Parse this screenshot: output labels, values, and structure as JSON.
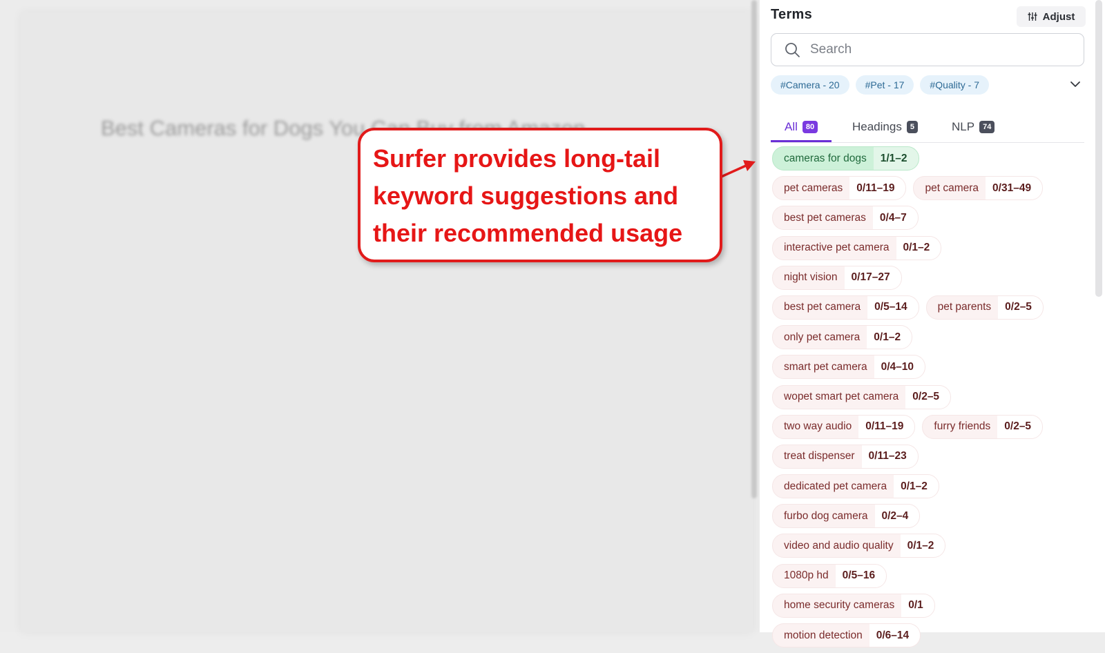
{
  "editor": {
    "title": "Best Cameras for Dogs You Can Buy from Amazon"
  },
  "panel": {
    "title": "Terms",
    "adjust_label": "Adjust",
    "search_placeholder": "Search",
    "topic_tags": [
      "#Camera - 20",
      "#Pet - 17",
      "#Quality - 7"
    ],
    "tabs": [
      {
        "label": "All",
        "count": "80"
      },
      {
        "label": "Headings",
        "count": "5"
      },
      {
        "label": "NLP",
        "count": "74"
      }
    ],
    "terms": [
      [
        {
          "name": "cameras for dogs",
          "count": "1/1–2",
          "status": "good"
        }
      ],
      [
        {
          "name": "pet cameras",
          "count": "0/11–19"
        },
        {
          "name": "pet camera",
          "count": "0/31–49"
        }
      ],
      [
        {
          "name": "best pet cameras",
          "count": "0/4–7"
        }
      ],
      [
        {
          "name": "interactive pet camera",
          "count": "0/1–2"
        }
      ],
      [
        {
          "name": "night vision",
          "count": "0/17–27"
        }
      ],
      [
        {
          "name": "best pet camera",
          "count": "0/5–14"
        },
        {
          "name": "pet parents",
          "count": "0/2–5"
        }
      ],
      [
        {
          "name": "only pet camera",
          "count": "0/1–2"
        }
      ],
      [
        {
          "name": "smart pet camera",
          "count": "0/4–10"
        }
      ],
      [
        {
          "name": "wopet smart pet camera",
          "count": "0/2–5"
        }
      ],
      [
        {
          "name": "two way audio",
          "count": "0/11–19"
        },
        {
          "name": "furry friends",
          "count": "0/2–5"
        }
      ],
      [
        {
          "name": "treat dispenser",
          "count": "0/11–23"
        }
      ],
      [
        {
          "name": "dedicated pet camera",
          "count": "0/1–2"
        }
      ],
      [
        {
          "name": "furbo dog camera",
          "count": "0/2–4"
        }
      ],
      [
        {
          "name": "video and audio quality",
          "count": "0/1–2"
        }
      ],
      [
        {
          "name": "1080p hd",
          "count": "0/5–16"
        }
      ],
      [
        {
          "name": "home security cameras",
          "count": "0/1"
        }
      ],
      [
        {
          "name": "motion detection",
          "count": "0/6–14"
        }
      ]
    ]
  },
  "callout": {
    "lines": [
      "Surfer provides long-tail",
      "keyword suggestions and",
      "their recommended usage"
    ]
  },
  "colors": {
    "accent": "#6a2fd6",
    "callout_red": "#e11b1b",
    "term_bg": "#fbf2f2",
    "good_bg": "#cdf1d9"
  }
}
